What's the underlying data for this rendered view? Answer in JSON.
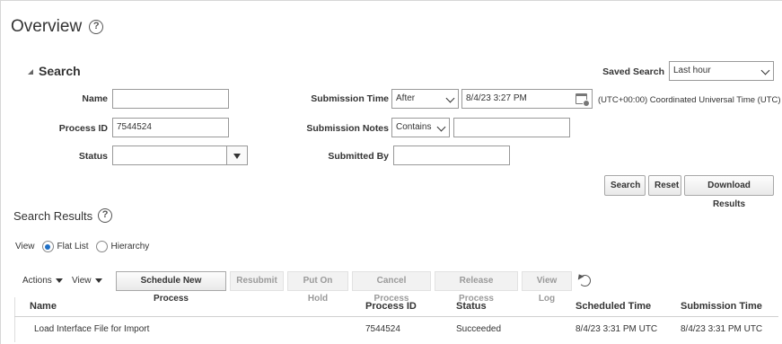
{
  "page": {
    "title": "Overview"
  },
  "search": {
    "header": "Search",
    "saved_search_label": "Saved Search",
    "saved_search_value": "Last hour",
    "name_label": "Name",
    "name_value": "",
    "process_id_label": "Process ID",
    "process_id_value": "7544524",
    "status_label": "Status",
    "status_value": "",
    "submission_time_label": "Submission Time",
    "submission_time_operator": "After",
    "submission_time_value": "8/4/23 3:27 PM",
    "timezone": "(UTC+00:00) Coordinated Universal Time (UTC)",
    "submission_notes_label": "Submission Notes",
    "submission_notes_operator": "Contains",
    "submission_notes_value": "",
    "submitted_by_label": "Submitted By",
    "submitted_by_value": "",
    "buttons": {
      "search": "Search",
      "reset": "Reset",
      "download": "Download Results"
    }
  },
  "results": {
    "title": "Search Results",
    "view_label": "View",
    "view_options": [
      "Flat List",
      "Hierarchy"
    ],
    "view_selected": "Flat List",
    "toolbar": {
      "actions": "Actions",
      "view": "View",
      "schedule": "Schedule New Process",
      "resubmit": "Resubmit",
      "put_on_hold": "Put On Hold",
      "cancel": "Cancel Process",
      "release": "Release Process",
      "view_log": "View Log"
    },
    "columns": [
      "Name",
      "Process ID",
      "Status",
      "Scheduled Time",
      "Submission Time"
    ],
    "rows": [
      [
        "Load Interface File for Import",
        "7544524",
        "Succeeded",
        "8/4/23 3:31 PM UTC",
        "8/4/23 3:31 PM UTC"
      ]
    ]
  },
  "icons": {
    "help": "help-icon",
    "collapse": "triangle-collapse-icon",
    "calendar": "calendar-icon",
    "refresh": "refresh-icon"
  }
}
